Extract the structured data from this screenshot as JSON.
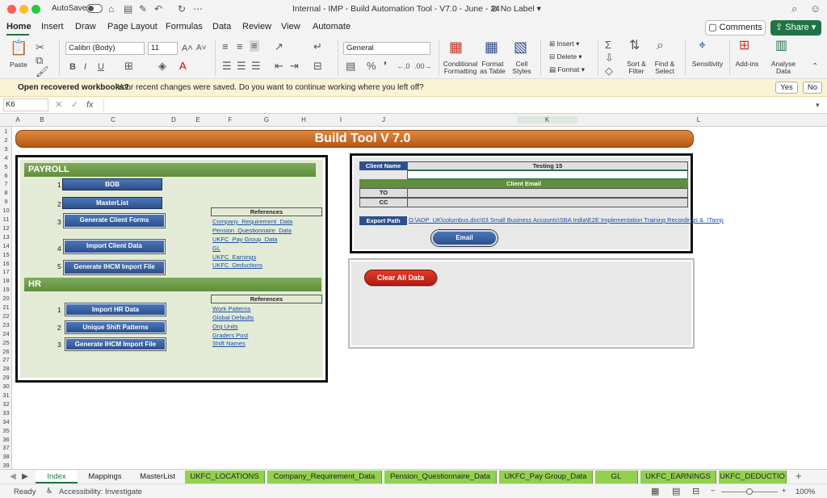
{
  "titlebar": {
    "autosave": "AutoSave",
    "doc_title": "Internal - IMP - Build Automation Tool - V7.0 - June - 24",
    "label": "No Label"
  },
  "ribbon_tabs": [
    "Home",
    "Insert",
    "Draw",
    "Page Layout",
    "Formulas",
    "Data",
    "Review",
    "View",
    "Automate"
  ],
  "comments_label": "Comments",
  "share_label": "Share",
  "ribbon": {
    "paste": "Paste",
    "font_name": "Calibri (Body)",
    "font_size": "11",
    "number_format": "General",
    "conditional_formatting": [
      "Conditional",
      "Formatting"
    ],
    "format_as_table": [
      "Format",
      "as Table"
    ],
    "cell_styles": [
      "Cell",
      "Styles"
    ],
    "insert": "Insert",
    "delete": "Delete",
    "format": "Format",
    "sort_filter": [
      "Sort &",
      "Filter"
    ],
    "find_select": [
      "Find &",
      "Select"
    ],
    "sensitivity": "Sensitivity",
    "add_ins": "Add-ins",
    "analyse_data": [
      "Analyse",
      "Data"
    ],
    "bold": "B",
    "italic": "I",
    "underline": "U",
    "font_grow": "A˄",
    "font_shrink": "A˅"
  },
  "infobar": {
    "title": "Open recovered workbooks?",
    "message": "Your recent changes were saved. Do you want to continue working where you left off?",
    "yes": "Yes",
    "no": "No"
  },
  "formula_bar": {
    "name_box": "K6",
    "fx": "fx"
  },
  "columns": [
    "A",
    "B",
    "C",
    "D",
    "E",
    "F",
    "G",
    "H",
    "I",
    "J",
    "K",
    "L"
  ],
  "rows": [
    "1",
    "2",
    "3",
    "4",
    "5",
    "6",
    "7",
    "8",
    "9",
    "10",
    "11",
    "12",
    "13",
    "14",
    "15",
    "16",
    "17",
    "18",
    "19",
    "20",
    "21",
    "22",
    "23",
    "24",
    "25",
    "26",
    "27",
    "28",
    "29",
    "30",
    "31",
    "32",
    "33",
    "34",
    "35",
    "36",
    "37",
    "38",
    "39"
  ],
  "banner": "Build Tool V 7.0",
  "payroll": {
    "title": "PAYROLL",
    "buttons": [
      {
        "num": "1",
        "label": "BOB"
      },
      {
        "num": "2",
        "label": "MasterList"
      },
      {
        "num": "3",
        "label": "Generate Client Forms"
      },
      {
        "num": "4",
        "label": "Import Client Data"
      },
      {
        "num": "5",
        "label": "Generate IHCM Import File"
      }
    ],
    "references_title": "References",
    "references": [
      "Company_Requirement_Data",
      "Pension_Questionnaire_Data",
      "UKFC_Pay Group_Data",
      "GL",
      "UKFC_Earnings",
      "UKFC_Deductions"
    ]
  },
  "hr": {
    "title": "HR",
    "buttons": [
      {
        "num": "1",
        "label": "Import HR Data"
      },
      {
        "num": "2",
        "label": "Unique Shift Patterns"
      },
      {
        "num": "3",
        "label": "Generate IHCM Import File"
      }
    ],
    "references_title": "References",
    "references": [
      "Work Patterns",
      "Global Defaults",
      "Org Units",
      "Graders Post",
      "Shift Names"
    ]
  },
  "email_panel": {
    "client_name_label": "Client Name",
    "client_name_value": "Testing 15",
    "client_email_label": "Client Email",
    "to_label": "TO",
    "cc_label": "CC",
    "export_path_label": "Export Path",
    "export_path_value": "O:\\ADP_UK\\columbus.doc\\03 Small Business Accounts\\SBA India\\E2E Implementation Training Recordings &_\\Tamp",
    "email_button": "Email"
  },
  "clear_button": "Clear All Data",
  "sheet_tabs": [
    {
      "label": "Index",
      "active": true
    },
    {
      "label": "Mappings"
    },
    {
      "label": "MasterList"
    },
    {
      "label": "UKFC_LOCATIONS",
      "green": true
    },
    {
      "label": "Company_Requirement_Data",
      "green": true
    },
    {
      "label": "Pension_Questionnaire_Data",
      "green": true
    },
    {
      "label": "UKFC_Pay Group_Data",
      "green": true
    },
    {
      "label": "GL",
      "green": true
    },
    {
      "label": "UKFC_EARNINGS",
      "green": true
    },
    {
      "label": "UKFC_DEDUCTIO",
      "green": true
    }
  ],
  "status": {
    "ready": "Ready",
    "accessibility": "Accessibility: Investigate",
    "zoom": "100%"
  },
  "colors": {
    "excel_green": "#217346",
    "tab_green": "#92d050",
    "banner_orange": "#c96a22",
    "section_green": "#6f9c4b",
    "button_blue": "#2d508d",
    "clear_red": "#c9281b"
  }
}
